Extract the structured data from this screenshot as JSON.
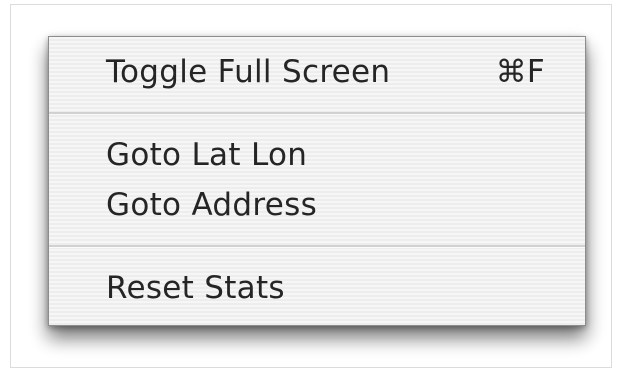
{
  "menu": {
    "items": [
      {
        "label": "Toggle Full Screen",
        "shortcut": "⌘F"
      },
      {
        "label": "Goto Lat Lon",
        "shortcut": ""
      },
      {
        "label": "Goto Address",
        "shortcut": ""
      },
      {
        "label": "Reset Stats",
        "shortcut": ""
      }
    ]
  }
}
